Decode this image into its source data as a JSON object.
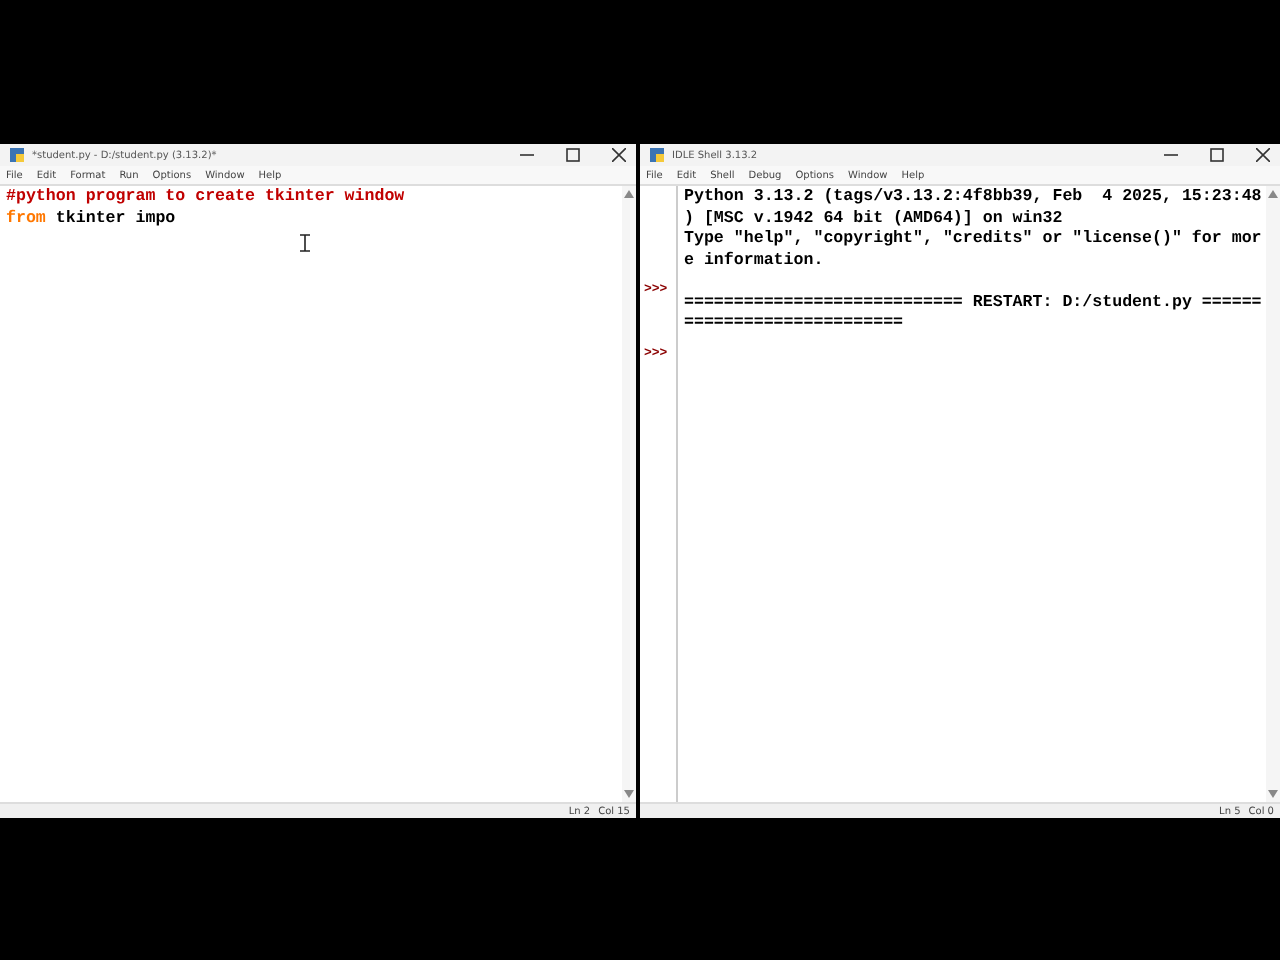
{
  "windows": [
    {
      "kind": "editor",
      "title": "*student.py - D:/student.py (3.13.2)*",
      "menu": [
        "File",
        "Edit",
        "Format",
        "Run",
        "Options",
        "Window",
        "Help"
      ],
      "lines": [
        {
          "tokens": [
            {
              "kind": "comment",
              "text": "#python program to create tkinter window"
            }
          ]
        },
        {
          "tokens": [
            {
              "kind": "keyword",
              "text": "from"
            },
            {
              "kind": "plain",
              "text": " tkinter impo"
            }
          ]
        }
      ],
      "status": [
        "Ln 2",
        "Col 15"
      ]
    },
    {
      "kind": "shell",
      "title": "IDLE Shell 3.13.2",
      "menu": [
        "File",
        "Edit",
        "Shell",
        "Debug",
        "Options",
        "Window",
        "Help"
      ],
      "lines": [
        {
          "tokens": [
            {
              "kind": "plain",
              "text": "Python 3.13.2 (tags/v3.13.2:4f8bb39, Feb  4 2025, 15:23:48"
            }
          ]
        },
        {
          "tokens": [
            {
              "kind": "plain",
              "text": ") [MSC v.1942 64 bit (AMD64)] on win32"
            }
          ]
        },
        {
          "tokens": [
            {
              "kind": "plain",
              "text": "Type \"help\", \"copyright\", \"credits\" or \"license()\" for mor"
            }
          ]
        },
        {
          "tokens": [
            {
              "kind": "plain",
              "text": "e information."
            }
          ]
        },
        {
          "prompt": ">>>"
        },
        {
          "tokens": [
            {
              "kind": "plain",
              "text": "============================ RESTART: D:/student.py ======"
            }
          ]
        },
        {
          "tokens": [
            {
              "kind": "plain",
              "text": "======================"
            }
          ]
        },
        {
          "prompt": ">>>"
        }
      ],
      "status": [
        "Ln 5",
        "Col 0"
      ]
    }
  ]
}
